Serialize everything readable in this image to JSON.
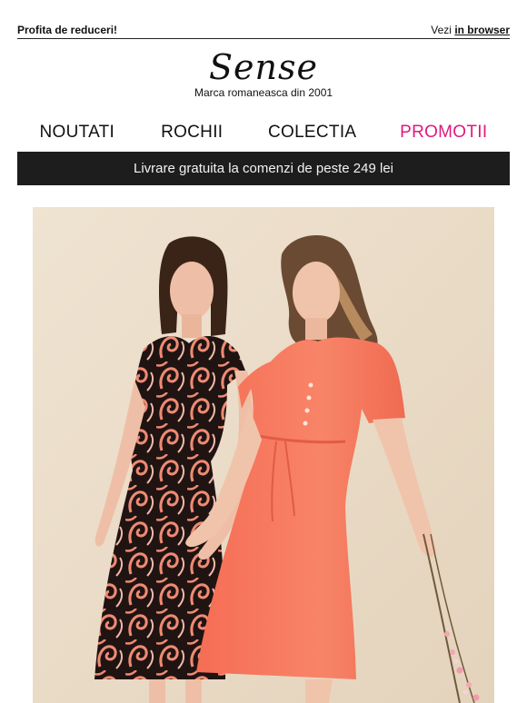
{
  "preheader": {
    "left_text": "Profita de reduceri!",
    "view_prefix": "Vezi",
    "view_link": "in browser"
  },
  "brand": {
    "logo_text": "Sense",
    "tagline": "Marca romaneasca din 2001"
  },
  "nav": {
    "items": [
      {
        "label": "NOUTATI"
      },
      {
        "label": "ROCHII"
      },
      {
        "label": "COLECTIA"
      },
      {
        "label": "PROMOTII"
      }
    ]
  },
  "shipping_banner": {
    "text": "Livrare gratuita la comenzi de peste 249 lei"
  },
  "colors": {
    "promo_accent": "#e0197d",
    "banner_background": "#1d1d1d",
    "hero_background": "#eaddc9",
    "coral_dress": "#f77d63"
  }
}
